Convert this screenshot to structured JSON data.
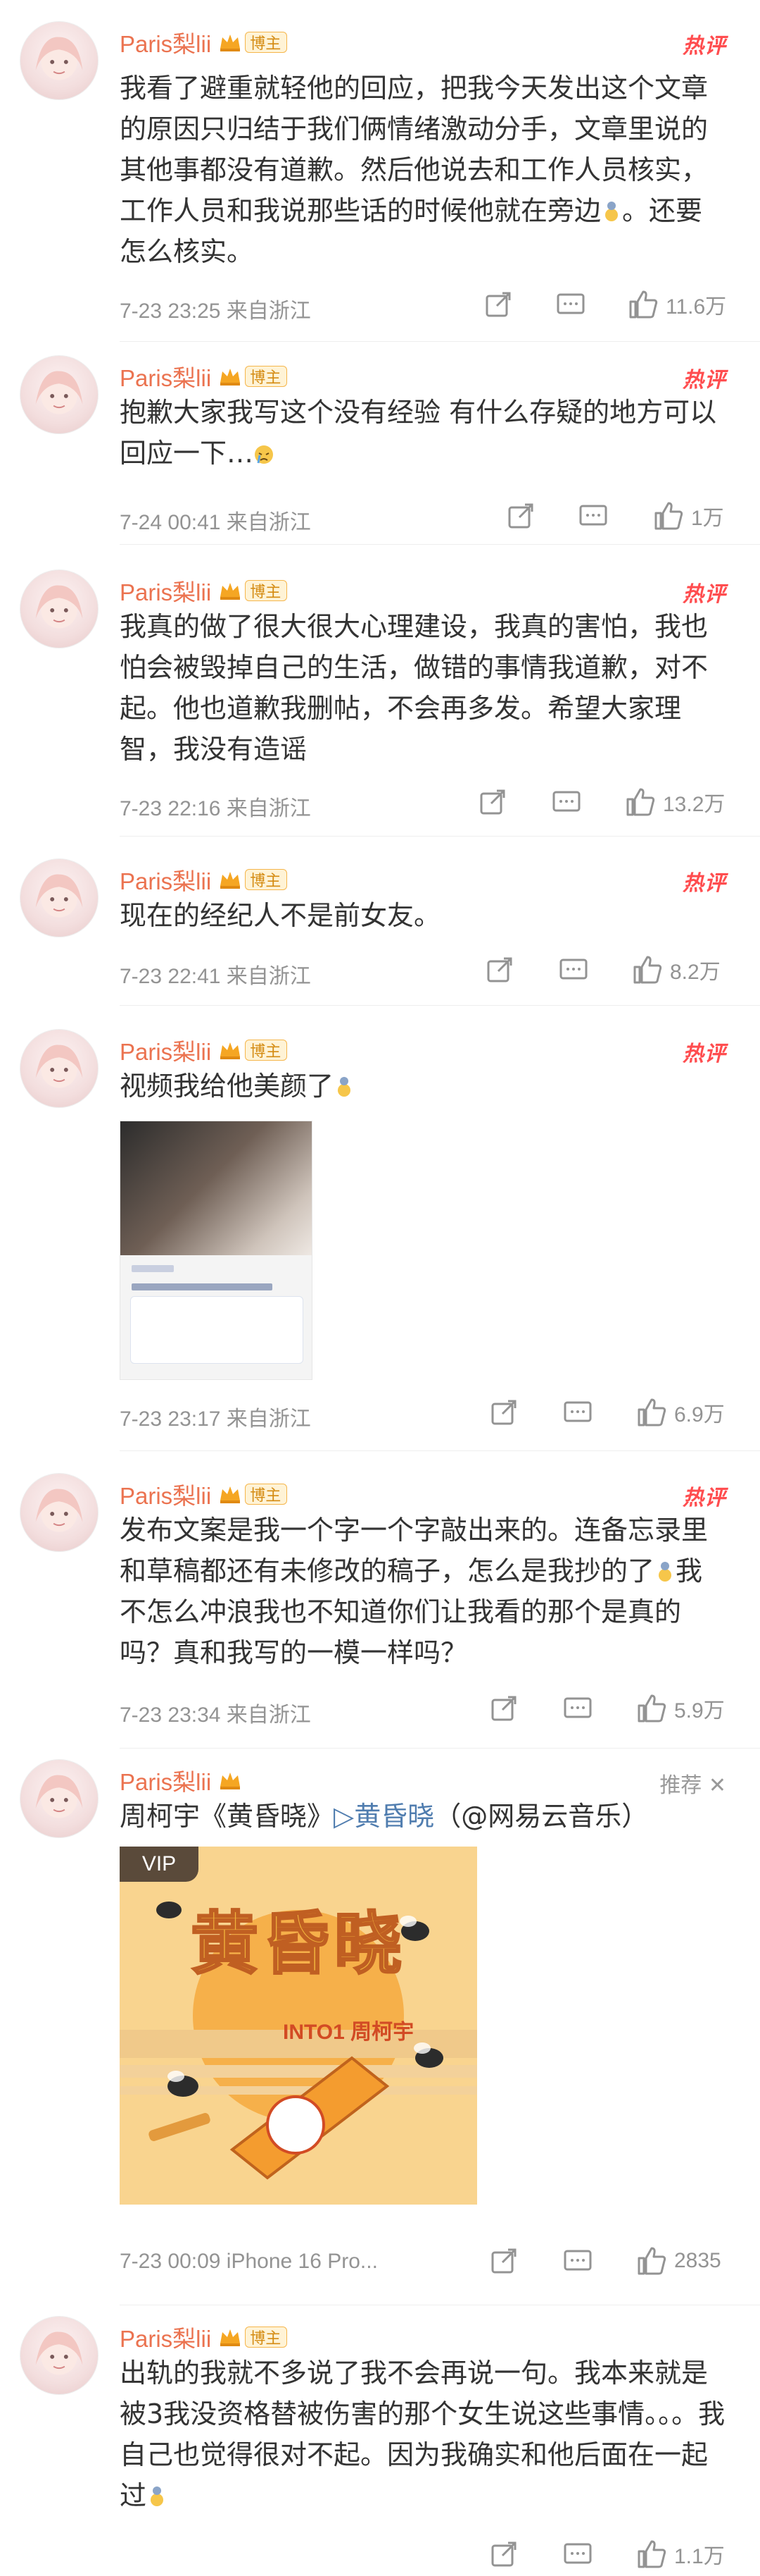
{
  "posts": [
    {
      "name": "Paris梨lii",
      "badge": "博主",
      "tag": "热评",
      "text": "我看了避重就轻他的回应，把我今天发出这个文章的原因只归结于我们俩情绪激动分手，文章里说的其他事都没有道歉。然后他说去和工作人员核实，工作人员和我说那些话的时候他就在旁边",
      "text_tail": "。还要怎么核实。",
      "time": "7-23 23:25 来自浙江",
      "likes": "11.6万"
    },
    {
      "name": "Paris梨lii",
      "badge": "博主",
      "tag": "热评",
      "text": "抱歉大家我写这个没有经验 有什么存疑的地方可以回应一下…",
      "time": "7-24 00:41 来自浙江",
      "likes": "1万"
    },
    {
      "name": "Paris梨lii",
      "badge": "博主",
      "tag": "热评",
      "text": "我真的做了很大很大心理建设，我真的害怕，我也怕会被毁掉自己的生活，做错的事情我道歉，对不起。他也道歉我删帖，不会再多发。希望大家理智，我没有造谣",
      "time": "7-23 22:16 来自浙江",
      "likes": "13.2万"
    },
    {
      "name": "Paris梨lii",
      "badge": "博主",
      "tag": "热评",
      "text": "现在的经纪人不是前女友。",
      "time": "7-23 22:41 来自浙江",
      "likes": "8.2万"
    },
    {
      "name": "Paris梨lii",
      "badge": "博主",
      "tag": "热评",
      "text": "视频我给他美颜了",
      "time": "7-23 23:17 来自浙江",
      "likes": "6.9万"
    },
    {
      "name": "Paris梨lii",
      "badge": "博主",
      "tag": "热评",
      "text": "发布文案是我一个字一个字敲出来的。连备忘录里和草稿都还有未修改的稿子，怎么是我抄的了",
      "text_tail": "我不怎么冲浪我也不知道你们让我看的那个是真的吗？真和我写的一模一样吗？",
      "time": "7-23 23:34 来自浙江",
      "likes": "5.9万"
    },
    {
      "name": "Paris梨lii",
      "tag": "推荐",
      "text_pre": "周柯宇《黄昏晓》",
      "link_text": "黄昏晓",
      "text_post": "（@网易云音乐）",
      "vip": "VIP",
      "music_title": "黄昏晓",
      "music_sub": "INTO1 周柯宇",
      "time": "7-23 00:09 iPhone 16 Pro...",
      "likes": "2835"
    },
    {
      "name": "Paris梨lii",
      "badge": "博主",
      "text": "出轨的我就不多说了我不会再说一句。我本来就是被3我没资格替被伤害的那个女生说这些事情。。。我自己也觉得很对不起。因为我确实和他后面在一起过",
      "likes": "1.1万"
    }
  ],
  "colors": {
    "name": "#eb7350",
    "hot": "#ff4d4f",
    "meta": "#939393",
    "link": "#507daf"
  }
}
